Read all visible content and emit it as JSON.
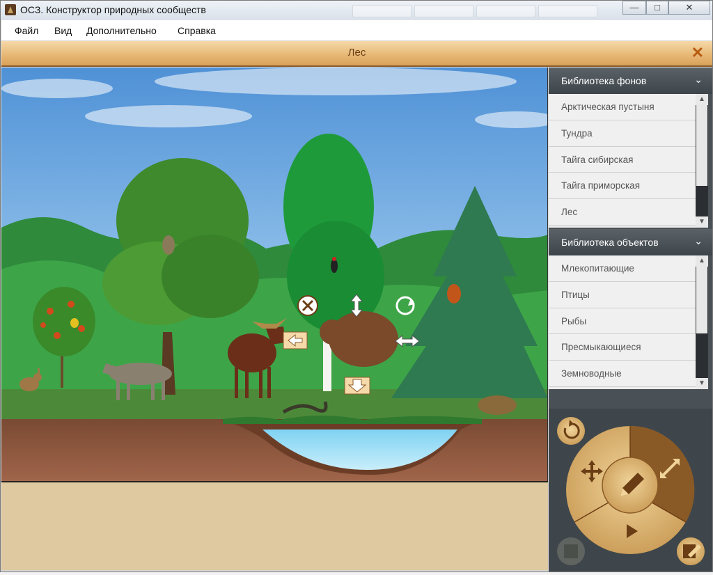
{
  "window": {
    "title": "ОСЗ. Конструктор природных сообществ",
    "minimize": "—",
    "maximize": "□",
    "close": "✕"
  },
  "menu": {
    "items": [
      "Файл",
      "Вид",
      "Дополнительно",
      "Справка"
    ]
  },
  "scene_header": {
    "title": "Лес",
    "close_icon": "close-x-icon"
  },
  "backgrounds_library": {
    "title": "Библиотека фонов",
    "items": [
      "Арктическая пустыня",
      "Тундра",
      "Тайга сибирская",
      "Тайга приморская",
      "Лес"
    ]
  },
  "objects_library": {
    "title": "Библиотека объектов",
    "items": [
      "Млекопитающие",
      "Птицы",
      "Рыбы",
      "Пресмыкающиеся",
      "Земноводные"
    ]
  },
  "colors": {
    "accent": "#d9a25a",
    "header_text": "#6b3d14",
    "panel": "#4a5156",
    "notes_bg": "#dfc9a1"
  }
}
